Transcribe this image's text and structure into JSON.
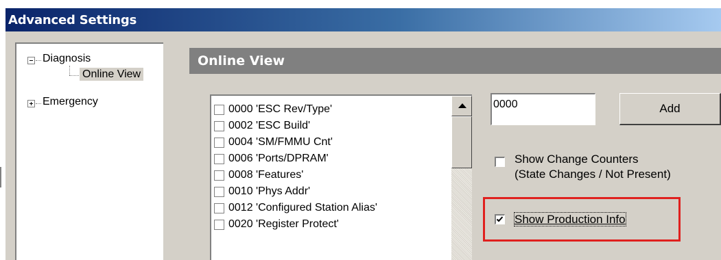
{
  "window": {
    "title": "Advanced Settings"
  },
  "tree": {
    "items": [
      {
        "label": "Diagnosis",
        "expander": "minus"
      },
      {
        "label": "Online View",
        "selected": true
      },
      {
        "label": "Emergency",
        "expander": "plus"
      }
    ]
  },
  "panel": {
    "header": "Online View"
  },
  "register_list": {
    "items": [
      {
        "label": "0000 'ESC Rev/Type'",
        "checked": false
      },
      {
        "label": "0002 'ESC Build'",
        "checked": false
      },
      {
        "label": "0004 'SM/FMMU Cnt'",
        "checked": false
      },
      {
        "label": "0006 'Ports/DPRAM'",
        "checked": false
      },
      {
        "label": "0008 'Features'",
        "checked": false
      },
      {
        "label": "0010 'Phys Addr'",
        "checked": false
      },
      {
        "label": "0012 'Configured Station Alias'",
        "checked": false
      },
      {
        "label": "0020 'Register Protect'",
        "checked": false
      }
    ]
  },
  "address_input": {
    "value": "0000"
  },
  "add_button": {
    "label": "Add"
  },
  "options": {
    "show_change_counters": {
      "line1": "Show Change Counters",
      "line2": "(State Changes / Not Present)",
      "checked": false
    },
    "show_production_info": {
      "label": "Show Production Info",
      "checked": true
    }
  },
  "colors": {
    "highlight": "#e0201e",
    "title_gradient_start": "#0a246a",
    "header_bg": "#808080"
  }
}
